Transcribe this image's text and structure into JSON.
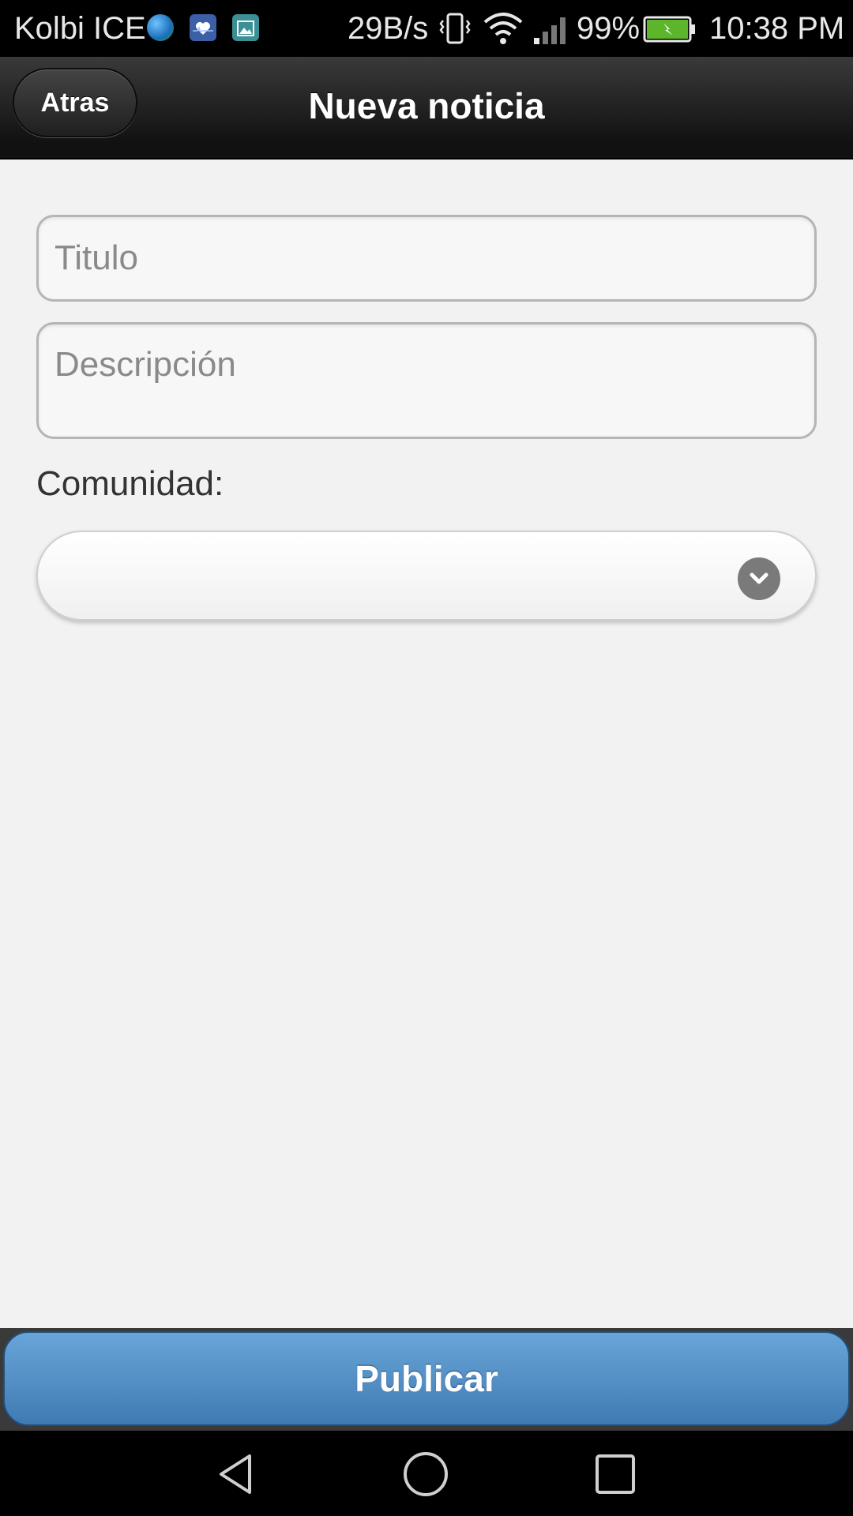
{
  "status_bar": {
    "carrier": "Kolbi ICE",
    "network_speed": "29B/s",
    "battery": "99%",
    "time": "10:38 PM",
    "icons": [
      "globe-icon",
      "health-icon",
      "gallery-icon",
      "vibrate-icon",
      "wifi-icon",
      "signal-icon",
      "battery-charging-icon"
    ]
  },
  "header": {
    "back_label": "Atras",
    "title": "Nueva noticia"
  },
  "form": {
    "titulo": {
      "placeholder": "Titulo",
      "value": ""
    },
    "descripcion": {
      "placeholder": "Descripción",
      "value": ""
    },
    "comunidad": {
      "label": "Comunidad:",
      "selected": ""
    }
  },
  "footer": {
    "publish_label": "Publicar"
  },
  "nav_bar": {
    "icons": [
      "back-triangle-icon",
      "home-circle-icon",
      "recents-square-icon"
    ]
  },
  "colors": {
    "header_bg": "#1c1c1c",
    "publish_button": "#5592c8",
    "page_bg": "#f2f2f2"
  }
}
